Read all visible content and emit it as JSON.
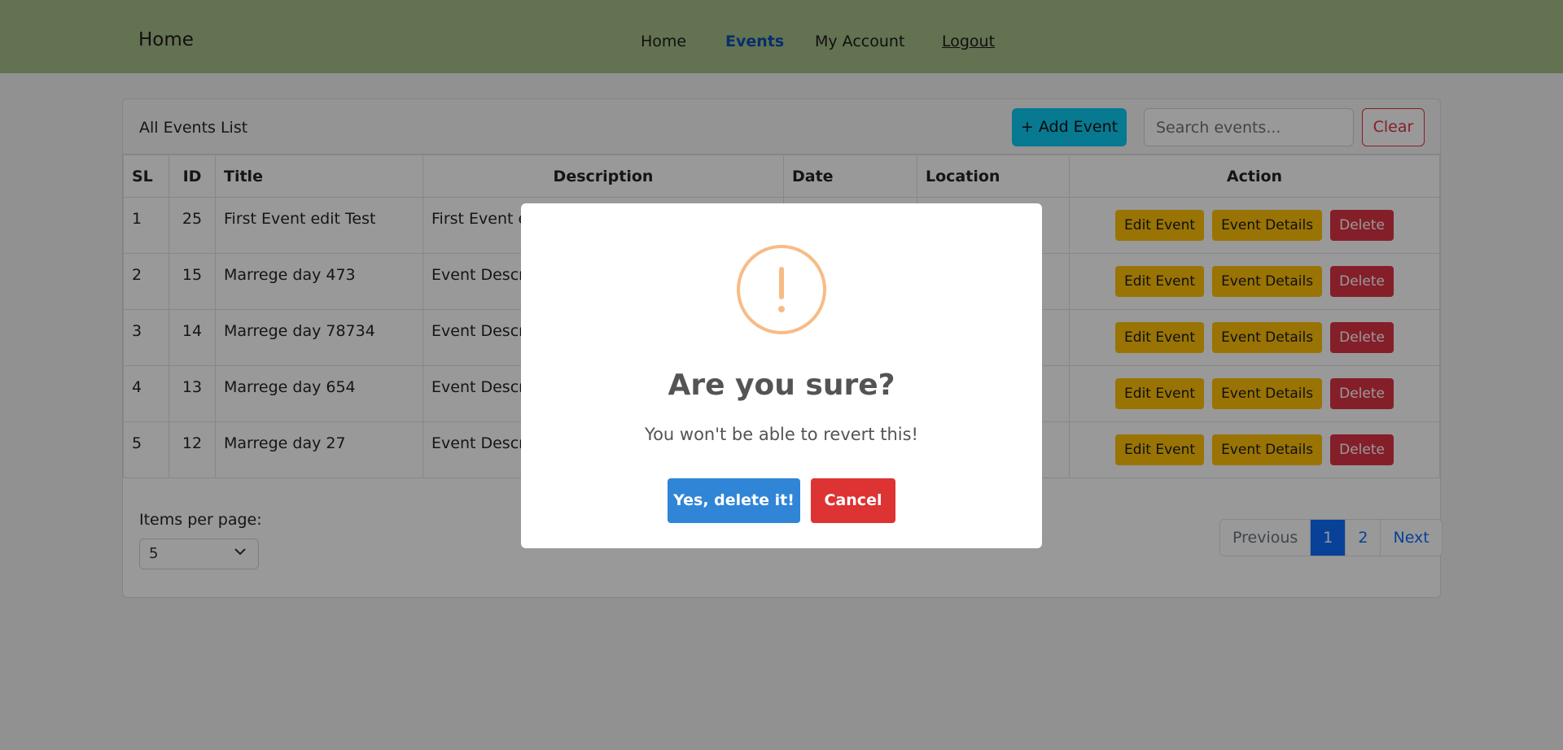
{
  "navbar": {
    "brand": "Home",
    "links": [
      {
        "label": "Home"
      },
      {
        "label": "Events"
      },
      {
        "label": "My Account"
      },
      {
        "label": "Logout"
      }
    ],
    "active": "Events"
  },
  "card": {
    "title": "All Events List",
    "add_label": "+ Add Event",
    "search_placeholder": "Search events...",
    "clear_label": "Clear"
  },
  "table": {
    "headers": [
      "SL",
      "ID",
      "Title",
      "Description",
      "Date",
      "Location",
      "Action"
    ],
    "rows": [
      {
        "sl": "1",
        "id": "25",
        "title": "First Event edit Test",
        "description": "First Event ed"
      },
      {
        "sl": "2",
        "id": "15",
        "title": "Marrege day 473",
        "description": "Event Descri"
      },
      {
        "sl": "3",
        "id": "14",
        "title": "Marrege day 78734",
        "description": "Event Descri"
      },
      {
        "sl": "4",
        "id": "13",
        "title": "Marrege day 654",
        "description": "Event Descri"
      },
      {
        "sl": "5",
        "id": "12",
        "title": "Marrege day 27",
        "description": "Event Descri"
      }
    ],
    "actions": {
      "edit": "Edit Event",
      "details": "Event Details",
      "delete": "Delete"
    }
  },
  "pagination": {
    "items_per_page_label": "Items per page:",
    "items_per_page_value": "5",
    "previous": "Previous",
    "pages": [
      "1",
      "2"
    ],
    "current_page": "1",
    "next": "Next"
  },
  "modal": {
    "icon": "exclamation-icon",
    "title": "Are you sure?",
    "text": "You won't be able to revert this!",
    "confirm_label": "Yes, delete it!",
    "cancel_label": "Cancel"
  },
  "colors": {
    "navbar": "#a6bf87",
    "active_link": "#0b4fb3",
    "add_button": "#0dcaf0",
    "warning_button": "#ffc107",
    "danger": "#dc3545",
    "primary": "#0d6efd",
    "confirm_button": "#3085d6",
    "cancel_button": "#dd3333",
    "warning_icon": "#f8bb86"
  }
}
